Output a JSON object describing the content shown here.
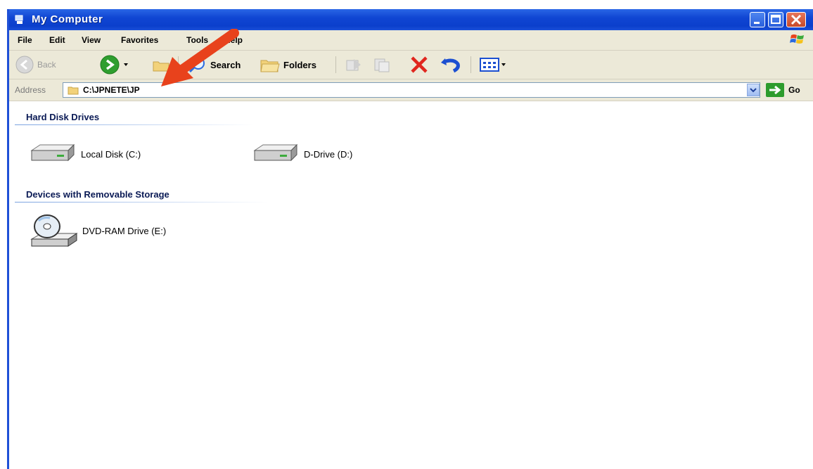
{
  "window": {
    "title": "My Computer"
  },
  "menu": {
    "items": [
      "File",
      "Edit",
      "View",
      "Favorites",
      "Tools",
      "Help"
    ]
  },
  "toolbar": {
    "back_label": "Back",
    "search_label": "Search",
    "folders_label": "Folders"
  },
  "address": {
    "label": "Address",
    "value": "C:\\JPNETE\\JP",
    "go_label": "Go"
  },
  "groups": [
    {
      "title": "Hard Disk Drives",
      "items": [
        {
          "label": "Local Disk (C:)",
          "icon": "hard-disk-icon"
        },
        {
          "label": "D-Drive (D:)",
          "icon": "hard-disk-icon"
        }
      ]
    },
    {
      "title": "Devices with Removable Storage",
      "items": [
        {
          "label": "DVD-RAM Drive (E:)",
          "icon": "dvd-drive-icon"
        }
      ]
    }
  ],
  "colors": {
    "title_bar": "#1046d3",
    "chrome": "#ece9d8",
    "annotation_arrow": "#e8421c"
  }
}
